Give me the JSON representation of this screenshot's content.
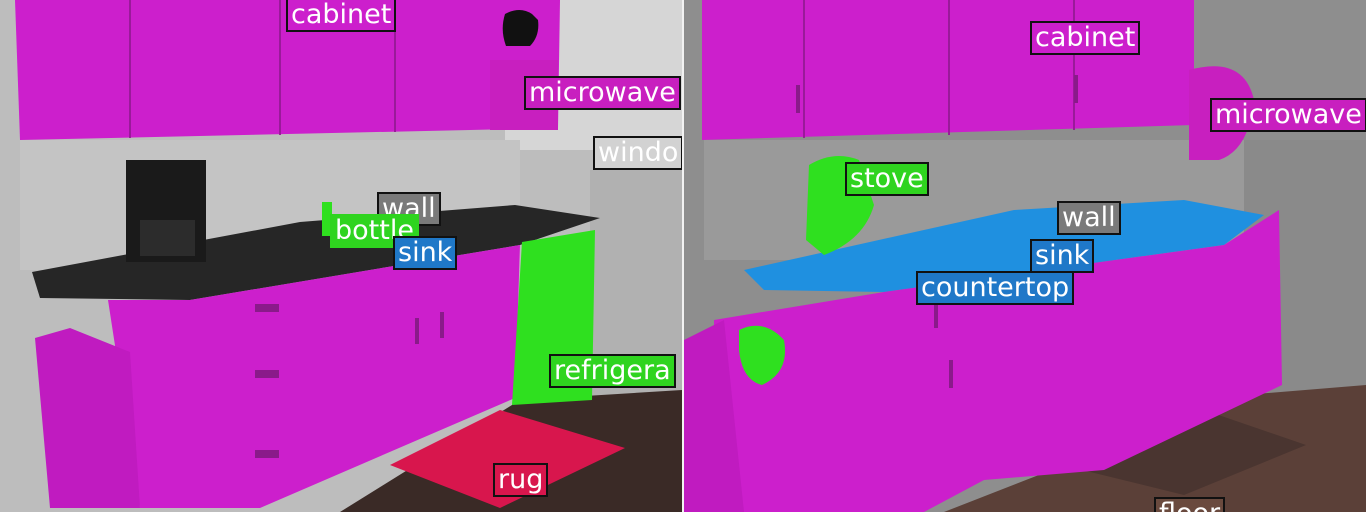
{
  "colors": {
    "cabinet": "#cc1fcc",
    "microwave": "#c81fbf",
    "window": "#d2d2d2",
    "wall": "#7a7a7a",
    "bottle": "#2fd41f",
    "sink": "#1f78c8",
    "refrigerator": "#2fd41f",
    "rug": "#d8164d",
    "stove": "#2fd41f",
    "countertop": "#1f78c8",
    "floor": "#6a4a3e"
  },
  "left_panel": {
    "labels": [
      {
        "id": "cabinet",
        "text": "cabinet",
        "color": "cabinet"
      },
      {
        "id": "microwave",
        "text": "microwave",
        "color": "microwave"
      },
      {
        "id": "window",
        "text": "windo",
        "color": "window"
      },
      {
        "id": "wall",
        "text": "wall",
        "color": "wall"
      },
      {
        "id": "bottle",
        "text": "bottle",
        "color": "bottle"
      },
      {
        "id": "sink",
        "text": "sink",
        "color": "sink"
      },
      {
        "id": "refrigerator",
        "text": "refrigera",
        "color": "refrigerator"
      },
      {
        "id": "rug",
        "text": "rug",
        "color": "rug"
      }
    ]
  },
  "right_panel": {
    "labels": [
      {
        "id": "cabinet",
        "text": "cabinet",
        "color": "cabinet"
      },
      {
        "id": "microwave",
        "text": "microwave",
        "color": "microwave"
      },
      {
        "id": "stove",
        "text": "stove",
        "color": "stove"
      },
      {
        "id": "wall",
        "text": "wall",
        "color": "wall"
      },
      {
        "id": "sink",
        "text": "sink",
        "color": "sink"
      },
      {
        "id": "countertop",
        "text": "countertop",
        "color": "countertop"
      },
      {
        "id": "floor",
        "text": "floor",
        "color": "floor"
      }
    ]
  }
}
